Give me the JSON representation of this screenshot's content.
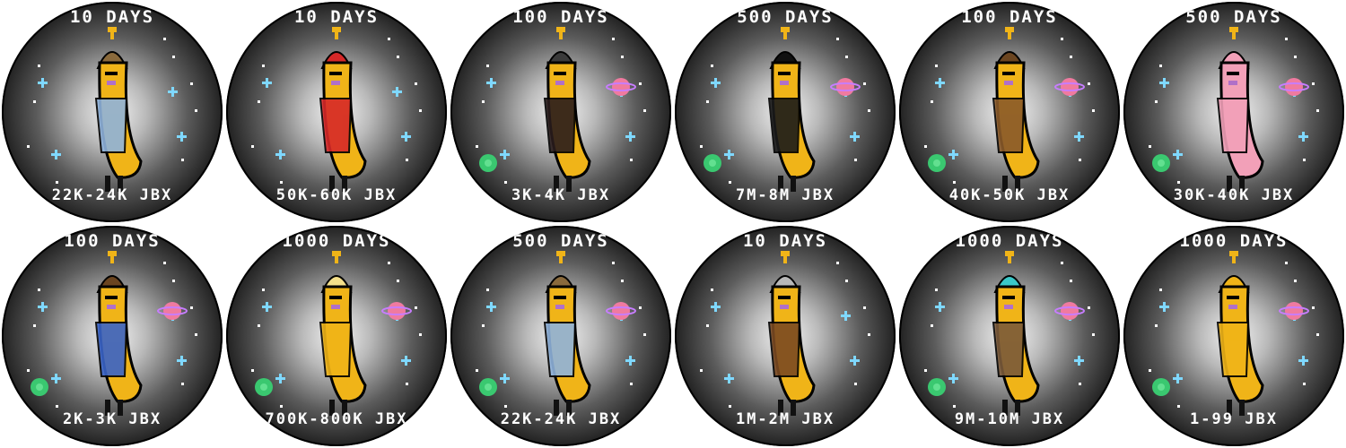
{
  "badges": [
    {
      "top": "10 DAYS",
      "bottom": "22K-24K JBX",
      "character": "musketeer-banana",
      "colors": {
        "body": "#f0b418",
        "outfit": "#8fb3dc",
        "hat": "#8a6a3c"
      },
      "planets": false
    },
    {
      "top": "10 DAYS",
      "bottom": "50K-60K JBX",
      "character": "santa-banana",
      "colors": {
        "body": "#f0b418",
        "outfit": "#d62828",
        "hat": "#d62828"
      },
      "planets": false
    },
    {
      "top": "100 DAYS",
      "bottom": "3K-4K JBX",
      "character": "witch-banana",
      "colors": {
        "body": "#f0b418",
        "outfit": "#2a1c1c",
        "hat": "#3a3a3a"
      },
      "planets": true
    },
    {
      "top": "500 DAYS",
      "bottom": "7M-8M JBX",
      "character": "vampire-banana",
      "colors": {
        "body": "#f0b418",
        "outfit": "#1a1a1a",
        "hat": "#111111"
      },
      "planets": true
    },
    {
      "top": "100 DAYS",
      "bottom": "40K-50K JBX",
      "character": "pirate-banana",
      "colors": {
        "body": "#f0b418",
        "outfit": "#8a5a2a",
        "hat": "#6b4520"
      },
      "planets": true
    },
    {
      "top": "500 DAYS",
      "bottom": "30K-40K JBX",
      "character": "pink-banana",
      "colors": {
        "body": "#f2a0b8",
        "outfit": "#f2a0b8",
        "hat": "#f2a0b8"
      },
      "planets": true
    },
    {
      "top": "100 DAYS",
      "bottom": "2K-3K JBX",
      "character": "dorothy-banana",
      "colors": {
        "body": "#f0b418",
        "outfit": "#3a64c8",
        "hat": "#6b4520"
      },
      "planets": true
    },
    {
      "top": "1000 DAYS",
      "bottom": "700K-800K JBX",
      "character": "samurai-banana",
      "colors": {
        "body": "#f0b418",
        "outfit": "#f0b418",
        "hat": "#f5e08a"
      },
      "planets": true
    },
    {
      "top": "500 DAYS",
      "bottom": "22K-24K JBX",
      "character": "musketeer-banana",
      "colors": {
        "body": "#f0b418",
        "outfit": "#8fb3dc",
        "hat": "#8a6a3c"
      },
      "planets": true
    },
    {
      "top": "10 DAYS",
      "bottom": "1M-2M JBX",
      "character": "jedi-banana",
      "colors": {
        "body": "#f0b418",
        "outfit": "#7a4a22",
        "hat": "#b8b8b8"
      },
      "planets": false
    },
    {
      "top": "1000 DAYS",
      "bottom": "9M-10M JBX",
      "character": "ghostbuster-banana",
      "colors": {
        "body": "#f0b418",
        "outfit": "#7a5a3a",
        "hat": "#3ac8c8"
      },
      "planets": true
    },
    {
      "top": "1000 DAYS",
      "bottom": "1-99 JBX",
      "character": "plain-banana",
      "colors": {
        "body": "#f0b418",
        "outfit": "#f0b418",
        "hat": "#f0b418"
      },
      "planets": true
    }
  ]
}
